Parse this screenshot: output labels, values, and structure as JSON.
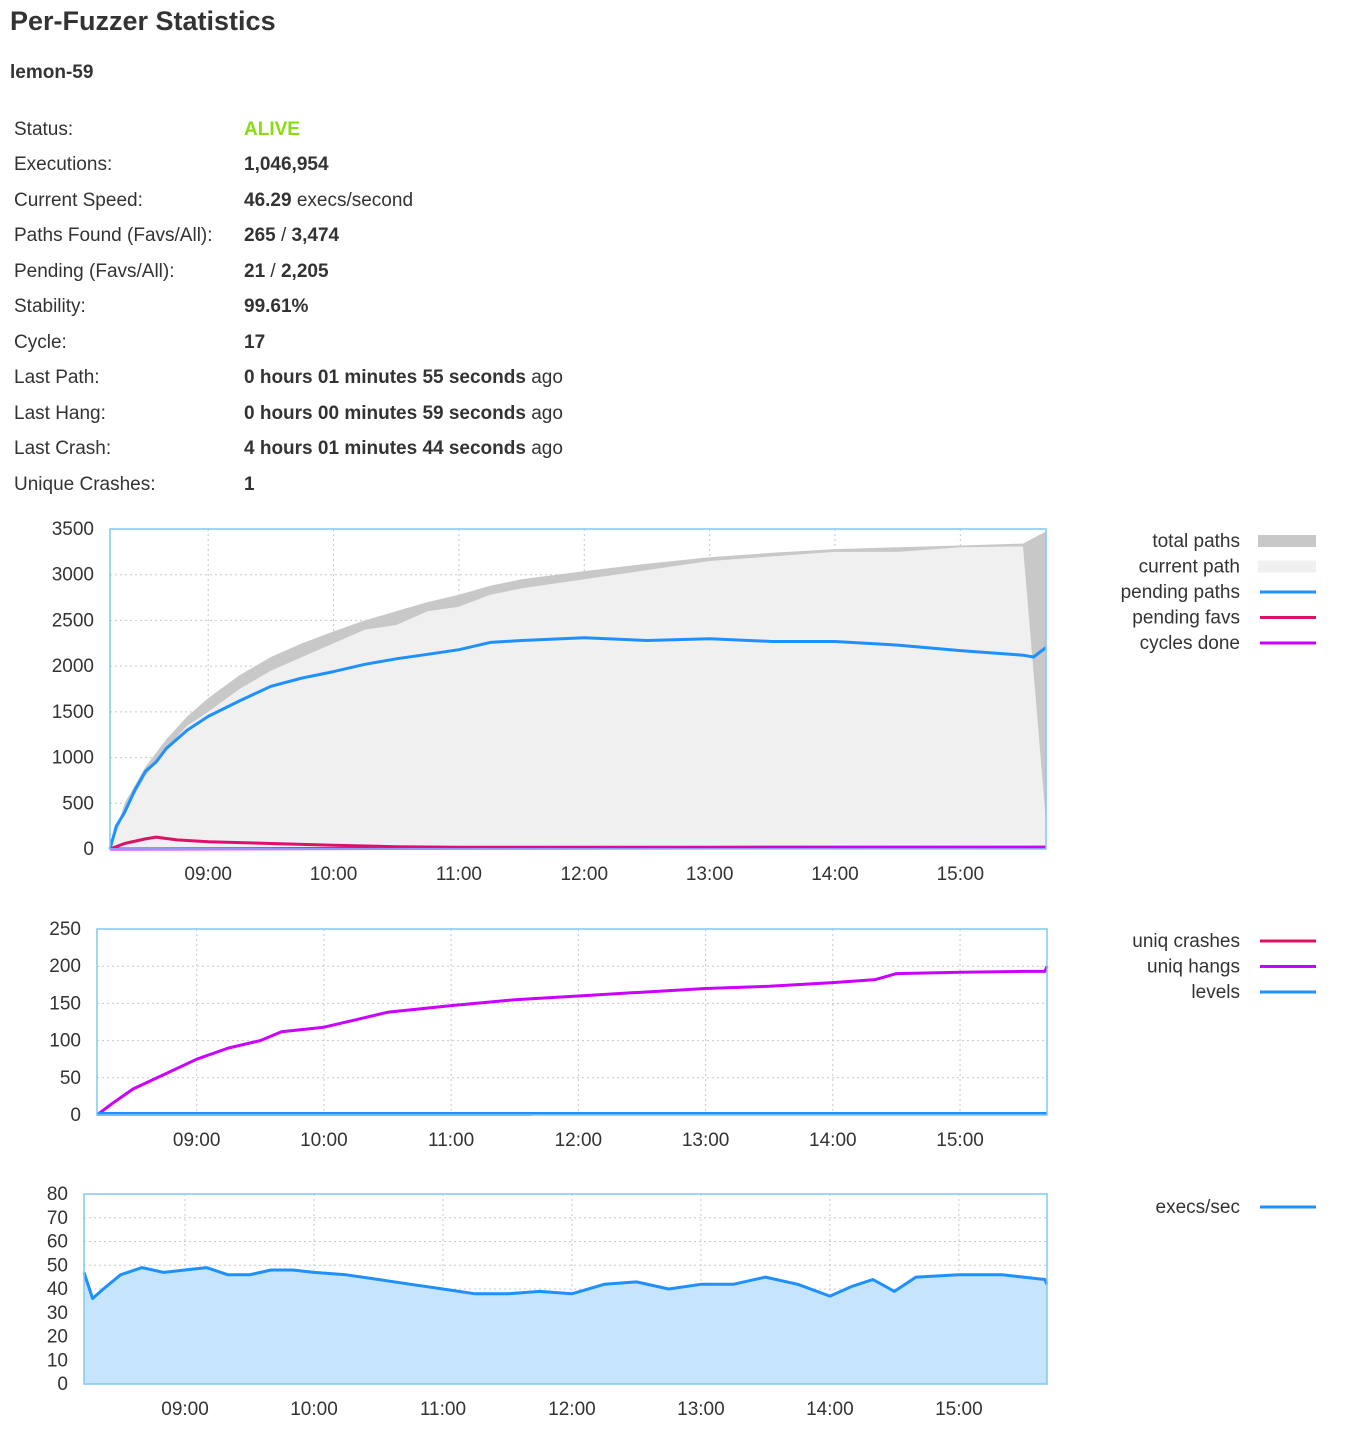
{
  "page": {
    "title": "Per-Fuzzer Statistics",
    "fuzzer_name": "lemon-59"
  },
  "stats": {
    "status_label": "Status:",
    "status_value": "ALIVE",
    "status_color": "#88dd11",
    "executions_label": "Executions:",
    "executions_value": "1,046,954",
    "speed_label": "Current Speed:",
    "speed_value": "46.29",
    "speed_unit": "execs/second",
    "paths_label": "Paths Found (Favs/All):",
    "paths_favs": "265",
    "paths_sep": "/",
    "paths_all": "3,474",
    "pending_label": "Pending (Favs/All):",
    "pending_favs": "21",
    "pending_sep": "/",
    "pending_all": "2,205",
    "stability_label": "Stability:",
    "stability_value": "99.61%",
    "cycle_label": "Cycle:",
    "cycle_value": "17",
    "last_path_label": "Last Path:",
    "last_path_value": "0 hours 01 minutes 55 seconds",
    "last_path_suffix": "ago",
    "last_hang_label": "Last Hang:",
    "last_hang_value": "0 hours 00 minutes 59 seconds",
    "last_hang_suffix": "ago",
    "last_crash_label": "Last Crash:",
    "last_crash_value": "4 hours 01 minutes 44 seconds",
    "last_crash_suffix": "ago",
    "unique_crashes_label": "Unique Crashes:",
    "unique_crashes_value": "1"
  },
  "chart_data": [
    {
      "type": "area",
      "title": "",
      "xlabel": "",
      "ylabel": "",
      "x_range": [
        "08:13",
        "15:41"
      ],
      "xticks": [
        "09:00",
        "10:00",
        "11:00",
        "12:00",
        "13:00",
        "14:00",
        "15:00"
      ],
      "ylim": [
        0,
        3500
      ],
      "yticks": [
        0,
        500,
        1000,
        1500,
        2000,
        2500,
        3000,
        3500
      ],
      "grid": true,
      "legend_position": "right",
      "series": [
        {
          "name": "total paths",
          "style": "area",
          "color": "#c8c8c8",
          "x": [
            "08:13",
            "08:20",
            "08:30",
            "08:40",
            "08:50",
            "09:00",
            "09:15",
            "09:30",
            "09:45",
            "10:00",
            "10:15",
            "10:30",
            "10:45",
            "11:00",
            "11:15",
            "11:30",
            "12:00",
            "12:30",
            "13:00",
            "13:30",
            "14:00",
            "14:30",
            "15:00",
            "15:30",
            "15:41"
          ],
          "y": [
            0,
            500,
            900,
            1200,
            1450,
            1650,
            1900,
            2100,
            2250,
            2380,
            2500,
            2600,
            2700,
            2780,
            2880,
            2950,
            3040,
            3120,
            3190,
            3240,
            3280,
            3300,
            3320,
            3340,
            3474
          ]
        },
        {
          "name": "current path",
          "style": "area",
          "color": "#f0f0f0",
          "x": [
            "08:13",
            "08:20",
            "08:30",
            "08:40",
            "08:50",
            "09:00",
            "09:15",
            "09:30",
            "09:45",
            "10:00",
            "10:15",
            "10:30",
            "10:45",
            "11:00",
            "11:15",
            "11:30",
            "12:00",
            "12:30",
            "13:00",
            "13:30",
            "14:00",
            "14:30",
            "15:00",
            "15:30",
            "15:41"
          ],
          "y": [
            0,
            400,
            800,
            1100,
            1350,
            1500,
            1750,
            1950,
            2100,
            2250,
            2400,
            2450,
            2600,
            2650,
            2780,
            2850,
            2950,
            3050,
            3150,
            3200,
            3250,
            3250,
            3300,
            3310,
            300
          ]
        },
        {
          "name": "pending paths",
          "style": "line",
          "color": "#1e90ff",
          "x": [
            "08:13",
            "08:16",
            "08:20",
            "08:25",
            "08:30",
            "08:35",
            "08:40",
            "08:50",
            "09:00",
            "09:15",
            "09:30",
            "09:45",
            "10:00",
            "10:15",
            "10:30",
            "10:45",
            "11:00",
            "11:15",
            "11:30",
            "12:00",
            "12:30",
            "13:00",
            "13:30",
            "14:00",
            "14:30",
            "15:00",
            "15:30",
            "15:35",
            "15:41"
          ],
          "y": [
            0,
            250,
            400,
            650,
            850,
            950,
            1100,
            1300,
            1450,
            1620,
            1780,
            1870,
            1940,
            2020,
            2080,
            2130,
            2180,
            2260,
            2280,
            2310,
            2280,
            2300,
            2270,
            2270,
            2230,
            2170,
            2120,
            2100,
            2205
          ]
        },
        {
          "name": "pending favs",
          "style": "line",
          "color": "#dd1166",
          "x": [
            "08:13",
            "08:20",
            "08:30",
            "08:35",
            "08:45",
            "09:00",
            "09:30",
            "10:00",
            "10:30",
            "11:00",
            "12:00",
            "13:00",
            "14:00",
            "15:00",
            "15:41"
          ],
          "y": [
            0,
            60,
            110,
            130,
            100,
            80,
            60,
            40,
            25,
            20,
            20,
            20,
            21,
            21,
            21
          ]
        },
        {
          "name": "cycles done",
          "style": "line",
          "color": "#cc00ff",
          "x": [
            "08:13",
            "15:41"
          ],
          "y": [
            0,
            17
          ]
        }
      ]
    },
    {
      "type": "line",
      "title": "",
      "xlabel": "",
      "ylabel": "",
      "x_range": [
        "08:13",
        "15:41"
      ],
      "xticks": [
        "09:00",
        "10:00",
        "11:00",
        "12:00",
        "13:00",
        "14:00",
        "15:00"
      ],
      "ylim": [
        0,
        250
      ],
      "yticks": [
        0,
        50,
        100,
        150,
        200,
        250
      ],
      "grid": true,
      "legend_position": "right",
      "series": [
        {
          "name": "uniq crashes",
          "color": "#dd1166",
          "x": [
            "08:13",
            "11:38"
          ],
          "y": [
            1,
            1
          ]
        },
        {
          "name": "uniq hangs",
          "color": "#cc00ff",
          "x": [
            "08:13",
            "08:20",
            "08:30",
            "08:45",
            "09:00",
            "09:15",
            "09:30",
            "09:40",
            "10:00",
            "10:15",
            "10:30",
            "11:00",
            "11:30",
            "12:00",
            "12:30",
            "13:00",
            "13:30",
            "14:00",
            "14:20",
            "14:30",
            "15:00",
            "15:30",
            "15:40",
            "15:41"
          ],
          "y": [
            0,
            15,
            35,
            55,
            75,
            90,
            100,
            112,
            118,
            128,
            138,
            147,
            155,
            160,
            165,
            170,
            173,
            178,
            182,
            190,
            192,
            193,
            193,
            200
          ]
        },
        {
          "name": "levels",
          "color": "#1e90ff",
          "x": [
            "08:13",
            "15:41"
          ],
          "y": [
            2,
            2
          ]
        }
      ]
    },
    {
      "type": "area",
      "title": "",
      "xlabel": "",
      "ylabel": "",
      "x_range": [
        "08:13",
        "15:41"
      ],
      "xticks": [
        "09:00",
        "10:00",
        "11:00",
        "12:00",
        "13:00",
        "14:00",
        "15:00"
      ],
      "ylim": [
        0,
        80
      ],
      "yticks": [
        0,
        10,
        20,
        30,
        40,
        50,
        60,
        70,
        80
      ],
      "grid": true,
      "legend_position": "right",
      "series": [
        {
          "name": "execs/sec",
          "color": "#1e90ff",
          "fill": "#c6e4fb",
          "x": [
            "08:13",
            "08:17",
            "08:22",
            "08:30",
            "08:40",
            "08:50",
            "09:00",
            "09:10",
            "09:20",
            "09:30",
            "09:40",
            "09:50",
            "10:00",
            "10:15",
            "10:30",
            "10:45",
            "11:00",
            "11:15",
            "11:30",
            "11:45",
            "12:00",
            "12:15",
            "12:30",
            "12:45",
            "13:00",
            "13:15",
            "13:30",
            "13:45",
            "14:00",
            "14:10",
            "14:20",
            "14:30",
            "14:40",
            "15:00",
            "15:20",
            "15:30",
            "15:40",
            "15:41"
          ],
          "y": [
            47,
            36,
            40,
            46,
            49,
            47,
            48,
            49,
            46,
            46,
            48,
            48,
            47,
            46,
            44,
            42,
            40,
            38,
            38,
            39,
            38,
            42,
            43,
            40,
            42,
            42,
            45,
            42,
            37,
            41,
            44,
            39,
            45,
            46,
            46,
            45,
            44,
            42
          ]
        }
      ]
    }
  ]
}
